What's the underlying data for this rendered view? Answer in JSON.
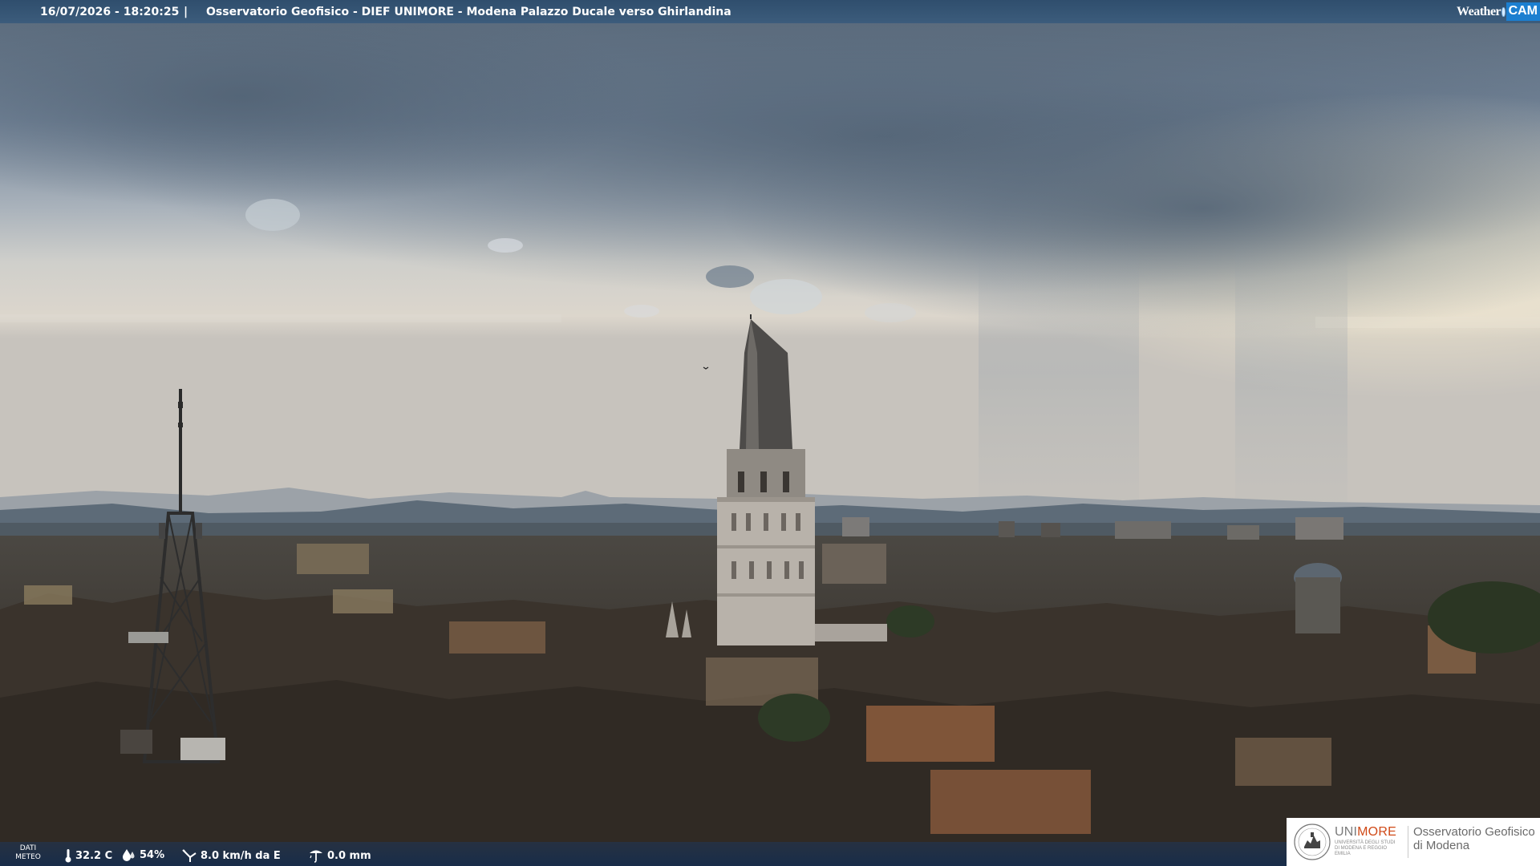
{
  "header": {
    "timestamp": "16/07/2026 - 18:20:25",
    "separator": "|",
    "camera_title": "Osservatorio Geofisico - DIEF UNIMORE - Modena Palazzo Ducale verso Ghirlandina",
    "brand_weather": "Weather",
    "brand_cam": "CAM"
  },
  "weather": {
    "label_line1": "DATI",
    "label_line2": "METEO",
    "temperature": "32.2 C",
    "humidity": "54%",
    "wind": "8.0 km/h da E",
    "rain": "0.0 mm"
  },
  "logo": {
    "uni_prefix": "UNI",
    "uni_suffix": "MORE",
    "uni_subtitle": "UNIVERSITÀ DEGLI STUDI DI MODENA E REGGIO EMILIA",
    "observatory_line1": "Osservatorio Geofisico",
    "observatory_line2": "di Modena"
  },
  "colors": {
    "header_bg": "#34536f",
    "brand_cam_bg": "#1c7fd0",
    "unimore_accent": "#d04a18"
  }
}
